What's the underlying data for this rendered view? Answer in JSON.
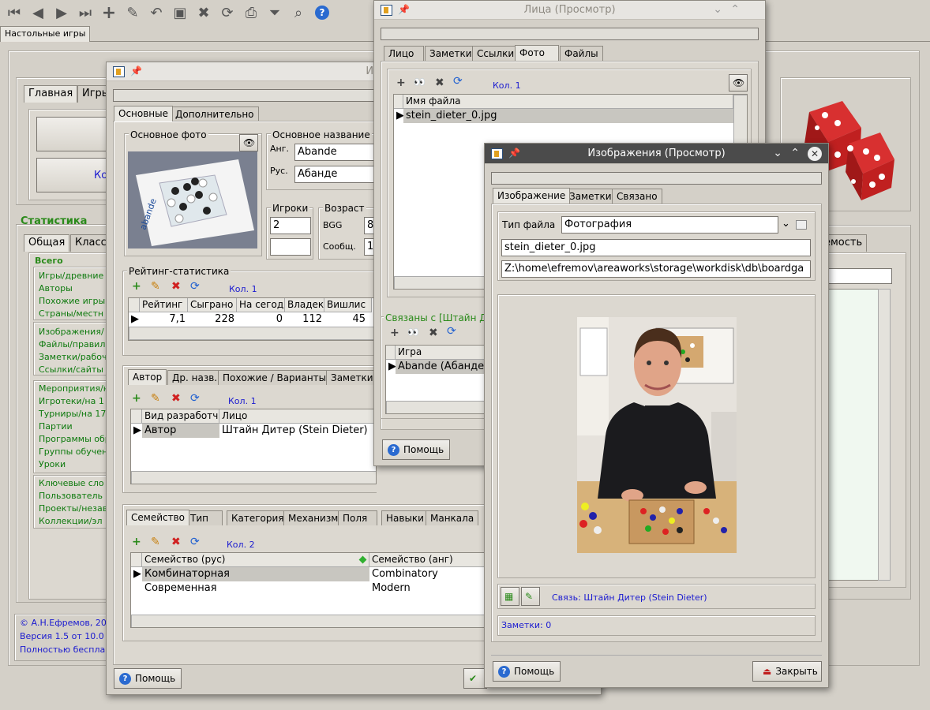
{
  "main": {
    "tab": "Настольные игры"
  },
  "toolbar": {
    "icons": [
      "first-icon",
      "prev-icon",
      "next-icon",
      "last-icon",
      "add-icon",
      "edit-icon",
      "undo-icon",
      "save-icon",
      "delete-icon",
      "refresh-icon",
      "print-icon",
      "filter-icon",
      "find-icon",
      "help-icon"
    ]
  },
  "bg": {
    "tabs": [
      "Главная",
      "Игры"
    ],
    "stats_title": "Статистика",
    "stat_tabs": [
      "Общая",
      "Класс"
    ],
    "right_tab": "емость",
    "kol": "Ко",
    "group_total": "Всего",
    "links1": [
      "Игры/древние",
      "Авторы",
      "Похожие игры",
      "Страны/местн"
    ],
    "links2": [
      "Изображения/",
      "Файлы/правил",
      "Заметки/рабоч",
      "Ссылки/сайты"
    ],
    "links3": [
      "Мероприятия/н",
      "Игротеки/на 1",
      "Турниры/на 17",
      "Партии",
      "Программы обр",
      "Группы обучен",
      "Уроки"
    ],
    "links4": [
      "Ключевые сло",
      "Пользователь",
      "Проекты/незав",
      "Коллекции/эл"
    ],
    "footer": [
      "© А.Н.Ефремов, 20",
      "Версия 1.5 от 10.0",
      "Полностью беспла"
    ]
  },
  "games": {
    "title": "Игры (Редактир",
    "tabs": [
      "Основные",
      "Дополнительно"
    ],
    "photo_label": "Основное фото",
    "name_label": "Основное название",
    "eng_label": "Анг.",
    "eng_value": "Abande",
    "rus_label": "Рус.",
    "rus_value": "Абанде",
    "players_label": "Игроки",
    "players_value": "2",
    "players_value2": "",
    "age_label": "Возраст",
    "bgg_label": "BGG",
    "bgg_value": "8",
    "soob_label": "Сообщ.",
    "soob_value": "1",
    "rating_label": "Рейтинг-статистика",
    "rating_count": "Кол. 1",
    "rating_headers": [
      "Рейтинг",
      "Сыграно",
      "На сегод",
      "Владек",
      "Вишлис"
    ],
    "rating_row": [
      "7,1",
      "228",
      "0",
      "112",
      "45"
    ],
    "author_tabs": [
      "Автор",
      "Др. назв.",
      "Похожие / Варианты",
      "Заметки"
    ],
    "author_count": "Кол. 1",
    "author_headers": [
      "Вид разработч",
      "Лицо"
    ],
    "author_row": [
      "Автор",
      "Штайн Дитер (Stein Dieter)"
    ],
    "family_tabs": [
      "Семейство",
      "Тип",
      "Категория",
      "Механизм",
      "Поля",
      "Навыки",
      "Манкала"
    ],
    "family_count": "Кол. 2",
    "family_headers": [
      "Семейство (рус)",
      "Семейство (анг)"
    ],
    "family_rows": [
      [
        "Комбинаторная",
        "Combinatory"
      ],
      [
        "Современная",
        "Modern"
      ]
    ],
    "help": "Помощь",
    "box_text": "abande"
  },
  "persons": {
    "title": "Лица (Просмотр)",
    "tabs": [
      "Лицо",
      "Заметки",
      "Ссылки",
      "Фото",
      "Файлы"
    ],
    "count": "Кол. 1",
    "file_header": "Имя файла",
    "file_row": "stein_dieter_0.jpg",
    "related_label": "Связаны с [Штайн Ди",
    "related_header": "Игра",
    "related_row": "Abande (Абанде",
    "help": "Помощь"
  },
  "images": {
    "title": "Изображения (Просмотр)",
    "tabs": [
      "Изображение",
      "Заметки",
      "Связано"
    ],
    "filetype_label": "Тип файла",
    "filetype_value": "Фотография",
    "filename": "stein_dieter_0.jpg",
    "path": "Z:\\home\\efremov\\areaworks\\storage\\workdisk\\db\\boardga",
    "link_text": "Связь: Штайн Дитер (Stein Dieter)",
    "notes_text": "Заметки: 0",
    "help": "Помощь",
    "close": "Закрыть"
  },
  "colors": {
    "accent": "#1a1ad0",
    "green": "#2a8a1a",
    "titlebar_active": "#4b4b4b"
  }
}
